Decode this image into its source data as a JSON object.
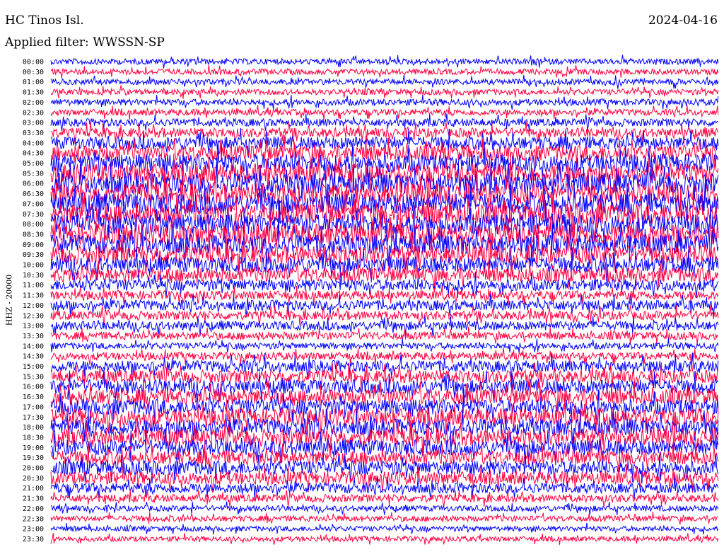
{
  "header": {
    "station": "HC Tinos Isl.",
    "date": "2024-04-16",
    "filter_text": "Applied filter: WWSSN-SP"
  },
  "chart_data": {
    "type": "line",
    "title": "HC Tinos Isl.",
    "subtitle": "Applied filter: WWSSN-SP",
    "ylabel": "HHZ - 20000",
    "xlabel": "",
    "grid": false,
    "legend": "none",
    "colors": [
      "#0000ff",
      "#ff0040"
    ],
    "row_labels": [
      "00:00",
      "00:30",
      "01:00",
      "01:30",
      "02:00",
      "02:30",
      "03:00",
      "03:30",
      "04:00",
      "04:30",
      "05:00",
      "05:30",
      "06:00",
      "06:30",
      "07:00",
      "07:30",
      "08:00",
      "08:30",
      "09:00",
      "09:30",
      "10:00",
      "10:30",
      "11:00",
      "11:30",
      "12:00",
      "12:30",
      "13:00",
      "13:30",
      "14:00",
      "14:30",
      "15:00",
      "15:30",
      "16:00",
      "16:30",
      "17:00",
      "17:30",
      "18:00",
      "18:30",
      "19:00",
      "19:30",
      "20:00",
      "20:30",
      "21:00",
      "21:30",
      "22:00",
      "22:30",
      "23:00",
      "23:30"
    ],
    "relative_amplitude": [
      0.45,
      0.45,
      0.45,
      0.45,
      0.5,
      0.5,
      0.6,
      0.75,
      1.0,
      1.2,
      1.4,
      1.5,
      1.6,
      1.6,
      1.6,
      1.6,
      1.6,
      1.6,
      1.5,
      1.4,
      1.2,
      1.1,
      0.9,
      0.7,
      0.8,
      0.7,
      0.7,
      0.6,
      0.5,
      0.6,
      0.9,
      1.0,
      1.1,
      1.2,
      1.2,
      1.3,
      1.3,
      1.3,
      1.2,
      1.1,
      1.1,
      1.0,
      0.8,
      0.6,
      0.45,
      0.45,
      0.4,
      0.4
    ]
  }
}
